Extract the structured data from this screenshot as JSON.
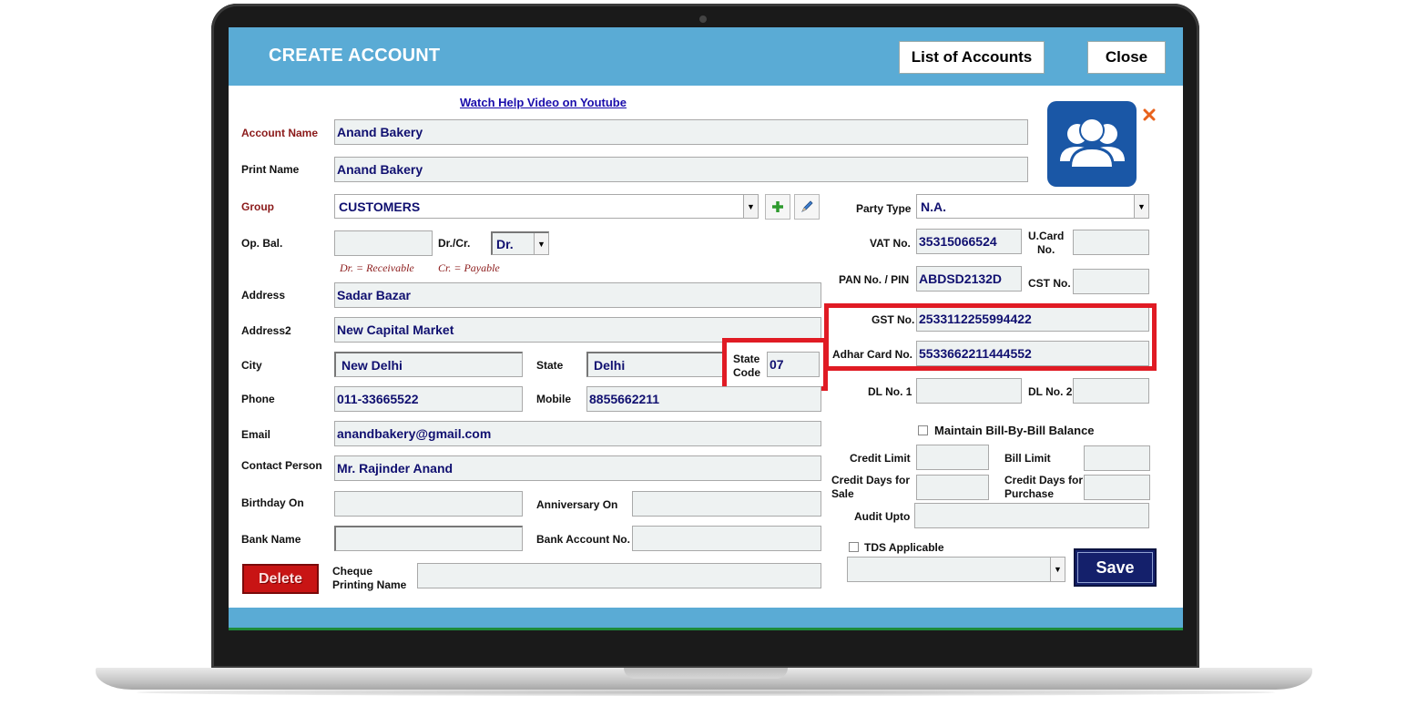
{
  "window": {
    "title": "CREATE ACCOUNT",
    "list_accounts_label": "List of Accounts",
    "close_label": "Close",
    "help_link": "Watch Help Video on Youtube"
  },
  "left": {
    "account_name": {
      "label": "Account Name",
      "value": "Anand Bakery"
    },
    "print_name": {
      "label": "Print Name",
      "value": "Anand Bakery"
    },
    "group": {
      "label": "Group",
      "value": "CUSTOMERS"
    },
    "op_bal": {
      "label": "Op. Bal.",
      "value": ""
    },
    "dr_cr": {
      "label": "Dr./Cr.",
      "value": "Dr."
    },
    "hint_dr": "Dr. = Receivable",
    "hint_cr": "Cr. = Payable",
    "address": {
      "label": "Address",
      "value": "Sadar Bazar"
    },
    "address2": {
      "label": "Address2",
      "value": "New Capital Market"
    },
    "city": {
      "label": "City",
      "value": "New Delhi"
    },
    "state": {
      "label": "State",
      "value": "Delhi"
    },
    "state_code": {
      "label_line1": "State",
      "label_line2": "Code",
      "value": "07"
    },
    "phone": {
      "label": "Phone",
      "value": "011-33665522"
    },
    "mobile": {
      "label": "Mobile",
      "value": "8855662211"
    },
    "email": {
      "label": "Email",
      "value": "anandbakery@gmail.com"
    },
    "contact_person": {
      "label": "Contact Person",
      "value": "Mr. Rajinder Anand"
    },
    "birthday": {
      "label": "Birthday On",
      "value": ""
    },
    "anniversary": {
      "label": "Anniversary On",
      "value": ""
    },
    "bank_name": {
      "label": "Bank Name",
      "value": ""
    },
    "bank_account": {
      "label": "Bank Account No.",
      "value": ""
    },
    "cheque_name": {
      "label_line1": "Cheque",
      "label_line2": "Printing Name",
      "value": ""
    },
    "delete_label": "Delete"
  },
  "right": {
    "party_type": {
      "label": "Party Type",
      "value": "N.A."
    },
    "vat_no": {
      "label": "VAT No.",
      "value": "35315066524"
    },
    "ucard_no": {
      "label_line1": "U.Card",
      "label_line2": "No.",
      "value": ""
    },
    "pan_no": {
      "label": "PAN No. / PIN",
      "value": "ABDSD2132D"
    },
    "cst_no": {
      "label": "CST No.",
      "value": ""
    },
    "gst_no": {
      "label": "GST No.",
      "value": "2533112255994422"
    },
    "adhar_no": {
      "label": "Adhar Card No.",
      "value": "5533662211444552"
    },
    "dl_no1": {
      "label": "DL No. 1",
      "value": ""
    },
    "dl_no2": {
      "label": "DL No. 2",
      "value": ""
    },
    "maintain_bill": {
      "label": "Maintain Bill-By-Bill Balance",
      "checked": false
    },
    "credit_limit": {
      "label": "Credit Limit",
      "value": ""
    },
    "bill_limit": {
      "label": "Bill Limit",
      "value": ""
    },
    "credit_days_sale": {
      "label_line1": "Credit Days for",
      "label_line2": "Sale",
      "value": ""
    },
    "credit_days_purchase": {
      "label_line1": "Credit Days for",
      "label_line2": "Purchase",
      "value": ""
    },
    "audit_upto": {
      "label": "Audit Upto",
      "value": ""
    },
    "tds": {
      "label": "TDS Applicable",
      "checked": false,
      "value": ""
    },
    "save_label": "Save"
  },
  "colors": {
    "titlebar": "#5aabd5",
    "highlight": "#e01b24",
    "save": "#14206b",
    "delete": "#c81414"
  }
}
